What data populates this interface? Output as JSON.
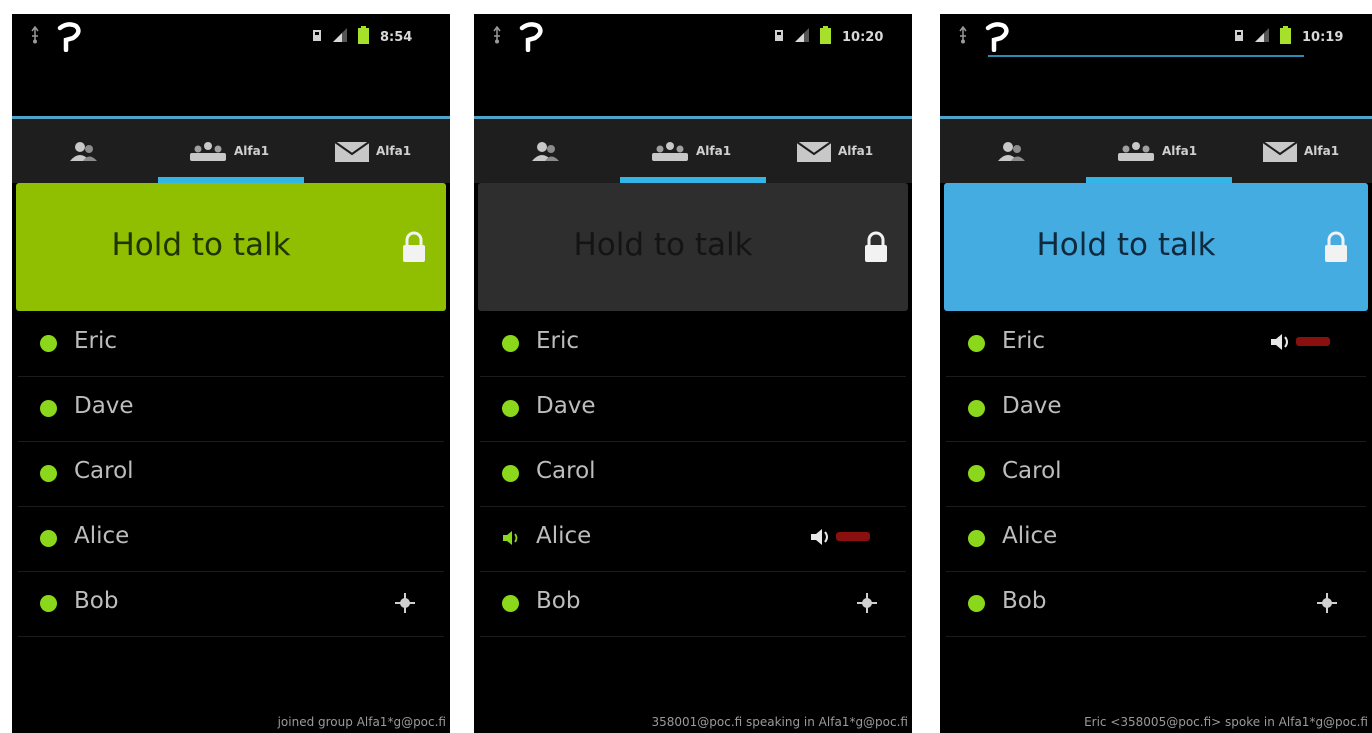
{
  "colors": {
    "phone_bg": "#000000",
    "tab_bg": "#1e1e1e",
    "tab_indicator": "#33b5e5",
    "presence_online": "#8bd71b",
    "audio_meter": "#8a1010"
  },
  "screens": [
    {
      "status": {
        "clock": "8:54"
      },
      "tabs": [
        {
          "icon": "contacts-icon",
          "label": "",
          "selected": false
        },
        {
          "icon": "group-icon",
          "label": "Alfa1",
          "selected": true
        },
        {
          "icon": "message-icon",
          "label": "Alfa1",
          "selected": false
        }
      ],
      "talk_button": {
        "label": "Hold to talk",
        "state": "transmitting",
        "bg": "#8fbf00",
        "text_color": "#1f3400",
        "lock_icon": "lock-icon"
      },
      "members": [
        {
          "name": "Eric",
          "status_icon": "presence-dot"
        },
        {
          "name": "Dave",
          "status_icon": "presence-dot"
        },
        {
          "name": "Carol",
          "status_icon": "presence-dot"
        },
        {
          "name": "Alice",
          "status_icon": "presence-dot"
        },
        {
          "name": "Bob",
          "status_icon": "presence-dot",
          "trailing_icon": "crosshair-icon"
        }
      ],
      "footer": "joined group Alfa1*g@poc.fi"
    },
    {
      "status": {
        "clock": "10:20"
      },
      "tabs": [
        {
          "icon": "contacts-icon",
          "label": "",
          "selected": false
        },
        {
          "icon": "group-icon",
          "label": "Alfa1",
          "selected": true
        },
        {
          "icon": "message-icon",
          "label": "Alfa1",
          "selected": false
        }
      ],
      "talk_button": {
        "label": "Hold to talk",
        "state": "busy",
        "bg": "#2e2e2e",
        "text_color": "#141414",
        "lock_icon": "lock-icon"
      },
      "members": [
        {
          "name": "Eric",
          "status_icon": "presence-dot"
        },
        {
          "name": "Dave",
          "status_icon": "presence-dot"
        },
        {
          "name": "Carol",
          "status_icon": "presence-dot"
        },
        {
          "name": "Alice",
          "status_icon": "speaking-icon",
          "trailing_icon": "speaker-icon",
          "meter": true
        },
        {
          "name": "Bob",
          "status_icon": "presence-dot",
          "trailing_icon": "crosshair-icon"
        }
      ],
      "footer": "358001@poc.fi speaking in Alfa1*g@poc.fi"
    },
    {
      "status": {
        "clock": "10:19"
      },
      "tabs": [
        {
          "icon": "contacts-icon",
          "label": "",
          "selected": false
        },
        {
          "icon": "group-icon",
          "label": "Alfa1",
          "selected": true
        },
        {
          "icon": "message-icon",
          "label": "Alfa1",
          "selected": false
        }
      ],
      "talk_button": {
        "label": "Hold to talk",
        "state": "idle",
        "bg": "#45ace2",
        "text_color": "#0f2a3d",
        "lock_icon": "lock-icon"
      },
      "members": [
        {
          "name": "Eric",
          "status_icon": "presence-dot",
          "trailing_icon": "speaker-icon",
          "meter": true
        },
        {
          "name": "Dave",
          "status_icon": "presence-dot"
        },
        {
          "name": "Carol",
          "status_icon": "presence-dot"
        },
        {
          "name": "Alice",
          "status_icon": "presence-dot"
        },
        {
          "name": "Bob",
          "status_icon": "presence-dot",
          "trailing_icon": "crosshair-icon"
        }
      ],
      "footer": "Eric <358005@poc.fi> spoke in Alfa1*g@poc.fi"
    }
  ]
}
